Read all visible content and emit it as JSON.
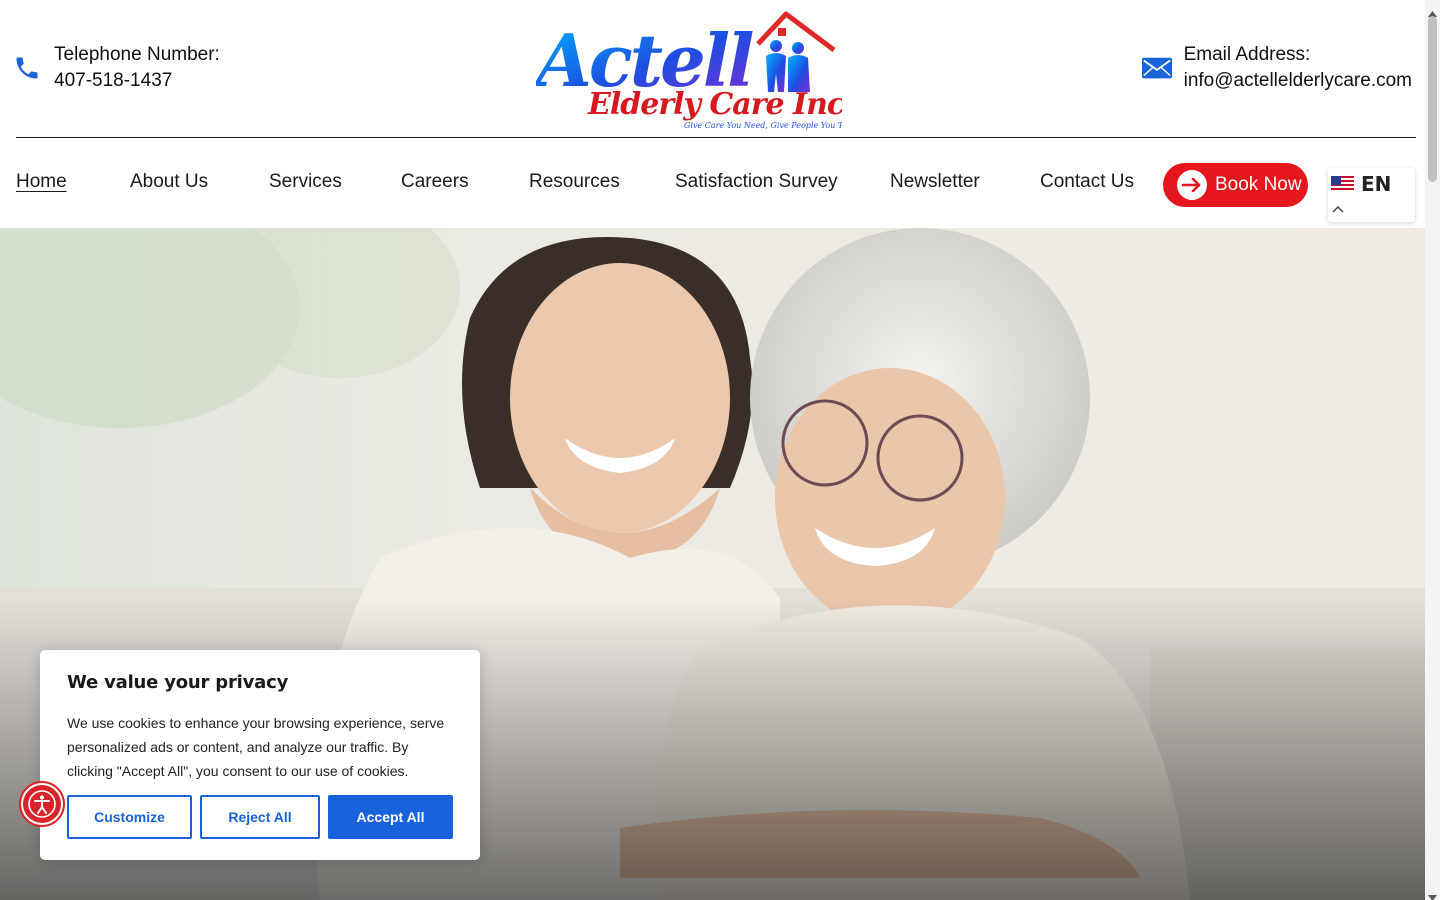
{
  "header": {
    "phone": {
      "label": "Telephone Number:",
      "value": "407-518-1437",
      "icon": "phone-icon"
    },
    "email": {
      "label": "Email Address:",
      "value": "info@actellelderlycare.com",
      "icon": "envelope-icon"
    },
    "logo": {
      "name": "Actell",
      "subtitle": "Elderly Care Inc",
      "tagline": "Give Care You Need, Give People You Trust"
    }
  },
  "nav": {
    "items": [
      {
        "label": "Home",
        "active": true
      },
      {
        "label": "About Us"
      },
      {
        "label": "Services"
      },
      {
        "label": "Careers"
      },
      {
        "label": "Resources"
      },
      {
        "label": "Satisfaction Survey"
      },
      {
        "label": "Newsletter"
      },
      {
        "label": "Contact Us"
      }
    ],
    "book_label": "Book Now",
    "language": {
      "code": "EN",
      "flag": "us-flag-icon"
    }
  },
  "cookie": {
    "title": "We value your privacy",
    "body": "We use cookies to enhance your browsing experience, serve personalized ads or content, and analyze our traffic. By clicking \"Accept All\", you consent to our use of cookies.",
    "customize_label": "Customize",
    "reject_label": "Reject All",
    "accept_label": "Accept All"
  },
  "colors": {
    "brand_red": "#e5161c",
    "consent_blue": "#1863dc",
    "phone_blue": "#1a63d8",
    "logo_blue": "#1d4fe0"
  }
}
